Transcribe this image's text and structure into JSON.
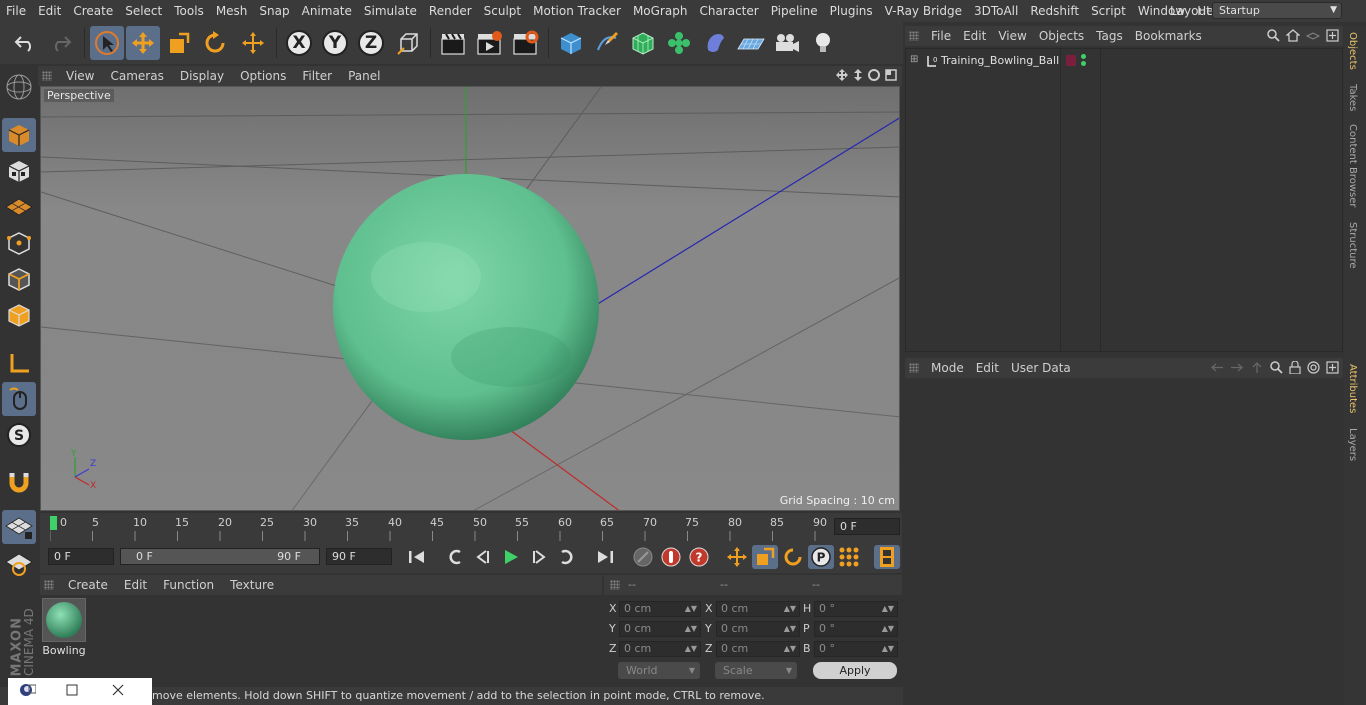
{
  "menu": [
    "File",
    "Edit",
    "Create",
    "Select",
    "Tools",
    "Mesh",
    "Snap",
    "Animate",
    "Simulate",
    "Render",
    "Sculpt",
    "Motion Tracker",
    "MoGraph",
    "Character",
    "Pipeline",
    "Plugins",
    "V-Ray Bridge",
    "3DToAll",
    "Redshift",
    "Script",
    "Window",
    "Help"
  ],
  "layout": {
    "label": "Layout:",
    "value": "Startup"
  },
  "toolbar": {
    "axis_x": "X",
    "axis_y": "Y",
    "axis_z": "Z"
  },
  "viewport": {
    "menu": [
      "View",
      "Cameras",
      "Display",
      "Options",
      "Filter",
      "Panel"
    ],
    "label": "Perspective",
    "grid_spacing": "Grid Spacing : 10 cm",
    "axis_labels": {
      "x": "X",
      "y": "Y",
      "z": "Z"
    },
    "object_color": "#5fbf8e"
  },
  "timeline": {
    "ticks": [
      "0",
      "5",
      "10",
      "15",
      "20",
      "25",
      "30",
      "35",
      "40",
      "45",
      "50",
      "55",
      "60",
      "65",
      "70",
      "75",
      "80",
      "85",
      "90"
    ],
    "current_frame": "0 F",
    "start_field": "0 F",
    "range_start": "0 F",
    "range_end": "90 F",
    "end_field": "90 F"
  },
  "materials": {
    "menu": [
      "Create",
      "Edit",
      "Function",
      "Texture"
    ],
    "items": [
      {
        "name": "Bowling"
      }
    ]
  },
  "coordinates": {
    "headers": [
      "--",
      "--",
      "--"
    ],
    "rows": [
      {
        "l1": "X",
        "v1": "0 cm",
        "l2": "X",
        "v2": "0 cm",
        "l3": "H",
        "v3": "0 °"
      },
      {
        "l1": "Y",
        "v1": "0 cm",
        "l2": "Y",
        "v2": "0 cm",
        "l3": "P",
        "v3": "0 °"
      },
      {
        "l1": "Z",
        "v1": "0 cm",
        "l2": "Z",
        "v2": "0 cm",
        "l3": "B",
        "v3": "0 °"
      }
    ],
    "space": "World",
    "mode": "Scale",
    "apply": "Apply"
  },
  "status": "move elements. Hold down SHIFT to quantize movement / add to the selection in point mode, CTRL to remove.",
  "objects": {
    "menu": [
      "File",
      "Edit",
      "View",
      "Objects",
      "Tags",
      "Bookmarks"
    ],
    "items": [
      {
        "name": "Training_Bowling_Ball",
        "tag_color": "#7a1f3d"
      }
    ]
  },
  "attributes": {
    "menu": [
      "Mode",
      "Edit",
      "User Data"
    ]
  },
  "right_tabs": [
    "Objects",
    "Takes",
    "Content Browser",
    "Structure",
    "Attributes",
    "Layers"
  ],
  "brand": {
    "line1": "MAXON",
    "line2": "CINEMA 4D"
  }
}
